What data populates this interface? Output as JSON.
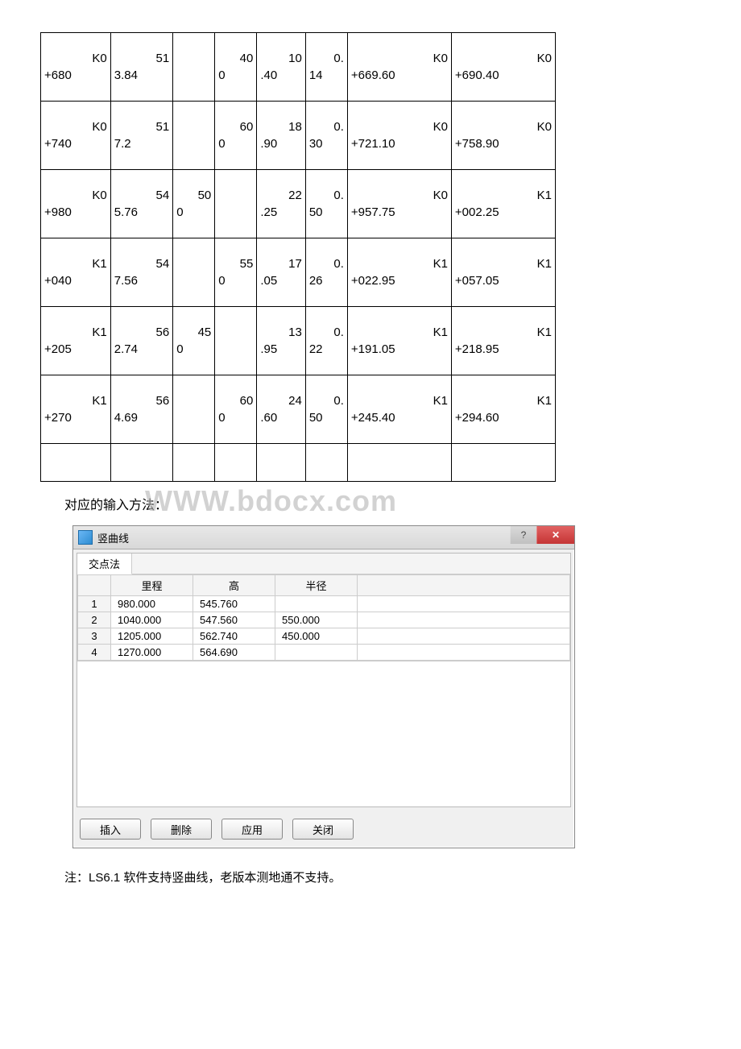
{
  "table": {
    "rows": [
      {
        "c0": "K0+680",
        "c1": "513.84",
        "c2": "",
        "c3": "400",
        "c4": "10.40",
        "c5": "0.14",
        "c6": "K0+669.60",
        "c7": "K0+690.40"
      },
      {
        "c0": "K0+740",
        "c1": "517.2",
        "c2": "",
        "c3": "600",
        "c4": "18.90",
        "c5": "0.30",
        "c6": "K0+721.10",
        "c7": "K0+758.90"
      },
      {
        "c0": "K0+980",
        "c1": "545.76",
        "c2": "500",
        "c3": "",
        "c4": "22.25",
        "c5": "0.50",
        "c6": "K0+957.75",
        "c7": "K1+002.25"
      },
      {
        "c0": "K1+040",
        "c1": "547.56",
        "c2": "",
        "c3": "550",
        "c4": "17.05",
        "c5": "0.26",
        "c6": "K1+022.95",
        "c7": "K1+057.05"
      },
      {
        "c0": "K1+205",
        "c1": "562.74",
        "c2": "450",
        "c3": "",
        "c4": "13.95",
        "c5": "0.22",
        "c6": "K1+191.05",
        "c7": "K1+218.95"
      },
      {
        "c0": "K1+270",
        "c1": "564.69",
        "c2": "",
        "c3": "600",
        "c4": "24.60",
        "c5": "0.50",
        "c6": "K1+245.40",
        "c7": "K1+294.60"
      },
      {
        "c0": "",
        "c1": "",
        "c2": "",
        "c3": "",
        "c4": "",
        "c5": "",
        "c6": "",
        "c7": ""
      }
    ]
  },
  "caption": "对应的输入方法：",
  "watermark": "WWW.bdocx.com",
  "dialog": {
    "title": "竖曲线",
    "tab": "交点法",
    "columns": {
      "mileage": "里程",
      "height": "高",
      "radius": "半径"
    },
    "rows": [
      {
        "n": "1",
        "mileage": "980.000",
        "height": "545.760",
        "radius": ""
      },
      {
        "n": "2",
        "mileage": "1040.000",
        "height": "547.560",
        "radius": "550.000"
      },
      {
        "n": "3",
        "mileage": "1205.000",
        "height": "562.740",
        "radius": "450.000"
      },
      {
        "n": "4",
        "mileage": "1270.000",
        "height": "564.690",
        "radius": ""
      }
    ],
    "buttons": {
      "insert": "插入",
      "delete": "删除",
      "apply": "应用",
      "close": "关闭"
    }
  },
  "note": "注：LS6.1 软件支持竖曲线，老版本测地通不支持。"
}
